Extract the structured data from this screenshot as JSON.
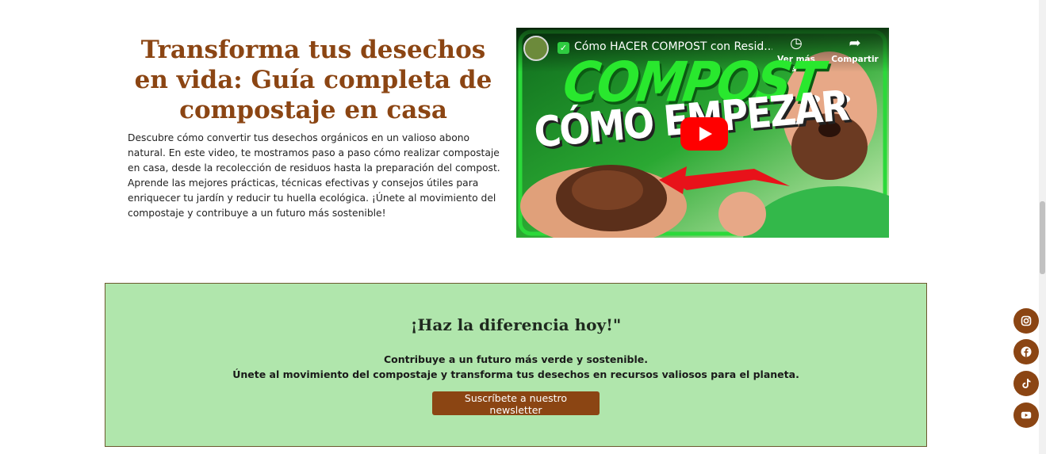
{
  "hero": {
    "title": "Transforma tus desechos en vida: Guía completa de compostaje en casa",
    "description": "Descubre cómo convertir tus desechos orgánicos en un valioso abono natural. En este video, te mostramos paso a paso cómo realizar compostaje en casa, desde la recolección de residuos hasta la preparación del compost. Aprende las mejores prácticas, técnicas efectivas y consejos útiles para enriquecer tu jardín y reducir tu huella ecológica. ¡Únete al movimiento del compostaje y contribuye a un futuro más sostenible!"
  },
  "video": {
    "title": "Cómo HACER COMPOST con Resid...",
    "watch_later_label": "Ver más ta...",
    "share_label": "Compartir",
    "thumbnail_line1": "COMPOST",
    "thumbnail_line2": "CÓMO EMPEZAR",
    "icons": [
      "clock-icon",
      "share-icon",
      "play-icon",
      "check-icon"
    ],
    "play_color": "#ff0000"
  },
  "cta": {
    "title": "¡Haz la diferencia hoy!\"",
    "line1": "Contribuye a un futuro más verde y sostenible.",
    "line2": "Únete al movimiento del compostaje y transforma tus desechos en recursos valiosos para el planeta.",
    "button_label": "Suscríbete a nuestro newsletter",
    "background": "#b0e6ac",
    "button_color": "#8b4513"
  },
  "social": {
    "items": [
      "instagram-icon",
      "facebook-icon",
      "tiktok-icon",
      "youtube-icon"
    ],
    "color": "#8b4513"
  },
  "colors": {
    "accent": "#8b4513"
  }
}
